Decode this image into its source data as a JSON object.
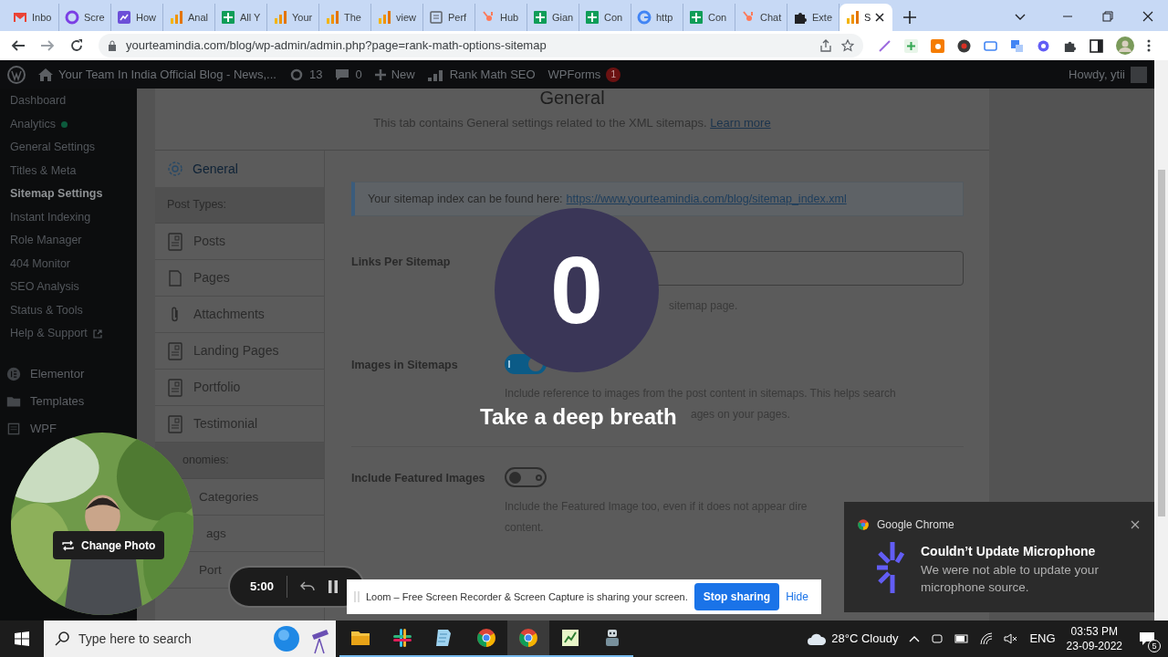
{
  "browser": {
    "tabs": [
      {
        "label": "Inbo",
        "kind": "mail",
        "selected": false
      },
      {
        "label": "Scre",
        "kind": "swirl",
        "selected": false
      },
      {
        "label": "How",
        "kind": "chart",
        "selected": false
      },
      {
        "label": "Anal",
        "kind": "bars",
        "selected": false
      },
      {
        "label": "All Y",
        "kind": "sheet",
        "selected": false
      },
      {
        "label": "Your",
        "kind": "bars",
        "selected": false
      },
      {
        "label": "The",
        "kind": "bars",
        "selected": false
      },
      {
        "label": "view",
        "kind": "bars",
        "selected": false
      },
      {
        "label": "Perf",
        "kind": "page",
        "selected": false
      },
      {
        "label": "Hub",
        "kind": "hub",
        "selected": false
      },
      {
        "label": "Gian",
        "kind": "sheet",
        "selected": false
      },
      {
        "label": "Con",
        "kind": "sheet",
        "selected": false
      },
      {
        "label": "http",
        "kind": "google",
        "selected": false
      },
      {
        "label": "Con",
        "kind": "sheet",
        "selected": false
      },
      {
        "label": "Chat",
        "kind": "hub",
        "selected": false
      },
      {
        "label": "Exte",
        "kind": "puzzle",
        "selected": false
      },
      {
        "label": "S",
        "kind": "bars",
        "selected": true
      }
    ],
    "url": "yourteamindia.com/blog/wp-admin/admin.php?page=rank-math-options-sitemap"
  },
  "admin_bar": {
    "site": "Your Team In India Official Blog - News,...",
    "updates": "13",
    "comments": "0",
    "new": "New",
    "rank_math": "Rank Math SEO",
    "wpforms": "WPForms",
    "wpforms_badge": "1",
    "howdy": "Howdy, ytii"
  },
  "sidebar": {
    "items": [
      {
        "label": "Dashboard",
        "kind": "plain",
        "selected": false
      },
      {
        "label": "Analytics",
        "kind": "dot",
        "selected": false
      },
      {
        "label": "General Settings",
        "kind": "plain",
        "selected": false
      },
      {
        "label": "Titles & Meta",
        "kind": "plain",
        "selected": false
      },
      {
        "label": "Sitemap Settings",
        "kind": "plain",
        "selected": true
      },
      {
        "label": "Instant Indexing",
        "kind": "plain",
        "selected": false
      },
      {
        "label": "Role Manager",
        "kind": "plain",
        "selected": false
      },
      {
        "label": "404 Monitor",
        "kind": "plain",
        "selected": false
      },
      {
        "label": "SEO Analysis",
        "kind": "plain",
        "selected": false
      },
      {
        "label": "Status & Tools",
        "kind": "plain",
        "selected": false
      },
      {
        "label": "Help & Support",
        "kind": "external",
        "selected": false
      }
    ],
    "menus": [
      {
        "label": "Elementor",
        "kind": "elementor"
      },
      {
        "label": "Templates",
        "kind": "folder"
      },
      {
        "label": "WPF",
        "kind": "form"
      }
    ]
  },
  "panel": {
    "title": "General",
    "description": "This tab contains General settings related to the XML sitemaps.",
    "learn_more": "Learn more",
    "nav": [
      {
        "kind": "tab",
        "label": "General",
        "selected": true
      },
      {
        "kind": "header",
        "label": "Post Types:"
      },
      {
        "kind": "doc-item",
        "label": "Posts",
        "selected": false
      },
      {
        "kind": "page-item",
        "label": "Pages",
        "selected": false
      },
      {
        "kind": "clip-item",
        "label": "Attachments",
        "selected": false
      },
      {
        "kind": "doc-item",
        "label": "Landing Pages",
        "selected": false
      },
      {
        "kind": "doc-item",
        "label": "Portfolio",
        "selected": false
      },
      {
        "kind": "doc-item",
        "label": "Testimonial",
        "selected": false
      },
      {
        "kind": "header",
        "label": "onomies:"
      },
      {
        "kind": "plain-item",
        "label": "Categories",
        "selected": false
      },
      {
        "kind": "plain-item",
        "label": "ags",
        "selected": false
      },
      {
        "kind": "plain-item",
        "label": "Port",
        "selected": false
      }
    ],
    "notice": {
      "text": "Your sitemap index can be found here:",
      "link": "https://www.yourteamindia.com/blog/sitemap_index.xml"
    },
    "fields": [
      {
        "kind": "input",
        "label": "Links Per Sitemap",
        "help_tail": "sitemap page."
      },
      {
        "kind": "toggle",
        "label": "Images in Sitemaps",
        "on": true,
        "help": [
          "Include reference to images from the post content in sitemaps. This helps search"
        ],
        "help_tail": "ages on your pages."
      },
      {
        "kind": "toggle",
        "label": "Include Featured Images",
        "on": false,
        "help": [
          "Include the Featured Image too, even if it does not appear dire",
          "content."
        ]
      }
    ]
  },
  "countdown": {
    "number": "0",
    "message": "Take a deep breath"
  },
  "camera": {
    "change_photo": "Change Photo"
  },
  "recorder": {
    "time": "5:00"
  },
  "sharing_bar": {
    "text": "Loom – Free Screen Recorder & Screen Capture is sharing your screen.",
    "stop": "Stop sharing",
    "hide": "Hide"
  },
  "notification": {
    "app": "Google Chrome",
    "title": "Couldn’t Update Microphone",
    "body": "We were not able to update your microphone source."
  },
  "taskbar": {
    "search_placeholder": "Type here to search",
    "apps": [
      {
        "kind": "folder",
        "selected": false
      },
      {
        "kind": "slack",
        "selected": false
      },
      {
        "kind": "notepad",
        "selected": false
      },
      {
        "kind": "chrome",
        "selected": false
      },
      {
        "kind": "chrome",
        "selected": true
      },
      {
        "kind": "editor",
        "selected": false
      },
      {
        "kind": "robot",
        "selected": false
      }
    ],
    "weather": "28°C  Cloudy",
    "language": "ENG",
    "time": "03:53 PM",
    "date": "23-09-2022",
    "notifications": "5"
  }
}
